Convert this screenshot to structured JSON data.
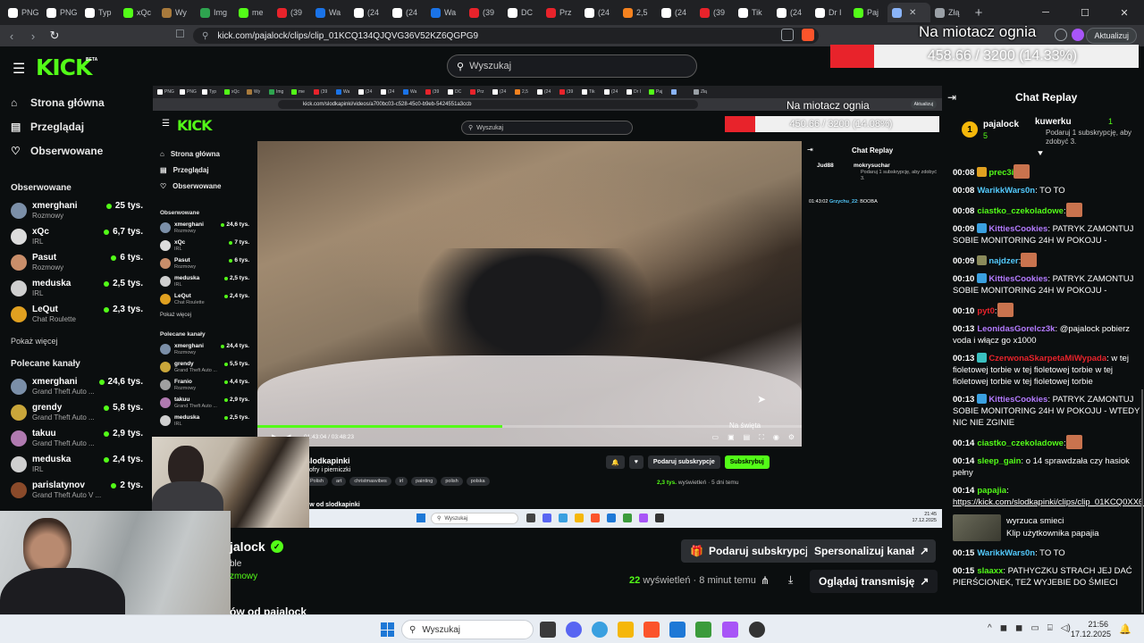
{
  "browser": {
    "tabs": [
      {
        "label": "PNG",
        "color": "#ffffff"
      },
      {
        "label": "PNG",
        "color": "#ffffff"
      },
      {
        "label": "Typ",
        "color": "#ffffff"
      },
      {
        "label": "xQc",
        "color": "#53fc18"
      },
      {
        "label": "Wy",
        "color": "#a87a3c"
      },
      {
        "label": "Img",
        "color": "#2ea44f"
      },
      {
        "label": "me",
        "color": "#53fc18"
      },
      {
        "label": "(39",
        "color": "#e8232b"
      },
      {
        "label": "Wa",
        "color": "#1a73e8"
      },
      {
        "label": "(24",
        "color": "#ffffff"
      },
      {
        "label": "(24",
        "color": "#ffffff"
      },
      {
        "label": "Wa",
        "color": "#1a73e8"
      },
      {
        "label": "(39",
        "color": "#e8232b"
      },
      {
        "label": "DC",
        "color": "#ffffff"
      },
      {
        "label": "Prz",
        "color": "#e8232b"
      },
      {
        "label": "(24",
        "color": "#ffffff"
      },
      {
        "label": "2,5",
        "color": "#f5821f"
      },
      {
        "label": "(24",
        "color": "#ffffff"
      },
      {
        "label": "(39",
        "color": "#e8232b"
      },
      {
        "label": "Tik",
        "color": "#ffffff"
      },
      {
        "label": "(24",
        "color": "#ffffff"
      },
      {
        "label": "Dr I",
        "color": "#ffffff"
      },
      {
        "label": "Paj",
        "color": "#53fc18"
      },
      {
        "label": "",
        "color": "#8ab4f8"
      },
      {
        "label": "Złą",
        "color": "#9aa0a6"
      }
    ],
    "new_tab": "+",
    "url": "kick.com/pajalock/clips/clip_01KCQ134QJQVG36V52KZ6QGPG9",
    "update_label": "Aktualizuj"
  },
  "overlay": {
    "title": "Na miotacz ognia",
    "current": 458.66,
    "goal": 3200,
    "value_text": "458.66 / 3200 (14.33%)"
  },
  "kick": {
    "logo": "KICK",
    "beta": "BETA",
    "search_placeholder": "Wyszukaj",
    "nav": [
      {
        "label": "Strona główna",
        "icon": "home-icon"
      },
      {
        "label": "Przeglądaj",
        "icon": "browse-icon"
      },
      {
        "label": "Obserwowane",
        "icon": "heart-icon"
      }
    ],
    "followed_title": "Obserwowane",
    "followed": [
      {
        "name": "xmerghani",
        "category": "Rozmowy",
        "viewers": "25 tys.",
        "color": "#7b8fa8"
      },
      {
        "name": "xQc",
        "category": "IRL",
        "viewers": "6,7 tys.",
        "color": "#dcdcdc"
      },
      {
        "name": "Pasut",
        "category": "Rozmowy",
        "viewers": "6 tys.",
        "color": "#c98e6a"
      },
      {
        "name": "meduska",
        "category": "IRL",
        "viewers": "2,5 tys.",
        "color": "#cfcfcf"
      },
      {
        "name": "LeQut",
        "category": "Chat Roulette",
        "viewers": "2,3 tys.",
        "color": "#e0a020"
      }
    ],
    "show_more": "Pokaż więcej",
    "recommended_title": "Polecane kanały",
    "recommended": [
      {
        "name": "xmerghani",
        "category": "Grand Theft Auto ...",
        "viewers": "24,6 tys.",
        "color": "#7b8fa8"
      },
      {
        "name": "grendy",
        "category": "Grand Theft Auto ...",
        "viewers": "5,8 tys.",
        "color": "#c9a63a"
      },
      {
        "name": "takuu",
        "category": "Grand Theft Auto ...",
        "viewers": "2,9 tys.",
        "color": "#b07ab0"
      },
      {
        "name": "meduska",
        "category": "IRL",
        "viewers": "2,4 tys.",
        "color": "#cfcfcf"
      },
      {
        "name": "parislatynov",
        "category": "Grand Theft Auto V ...",
        "viewers": "2 tys.",
        "color": "#8a4a2a"
      }
    ]
  },
  "inner": {
    "url": "kick.com/slodkapinki/videos/a700bc03-c528-45c0-b9eb-5424551a3ccb",
    "overlay_title": "Na miotacz ognia",
    "overlay_current": 450.66,
    "overlay_goal": 3200,
    "overlay_text": "450.66 / 3200 (14.08%)",
    "search_placeholder": "Wyszukaj",
    "update_label": "Aktualizuj",
    "nav": [
      "Strona główna",
      "Przeglądaj",
      "Obserwowane"
    ],
    "followed_title": "Obserwowane",
    "followed": [
      {
        "name": "xmerghani",
        "category": "Rozmowy",
        "viewers": "24,6 tys.",
        "color": "#7b8fa8"
      },
      {
        "name": "xQc",
        "category": "IRL",
        "viewers": "7 tys.",
        "color": "#dcdcdc"
      },
      {
        "name": "Pasut",
        "category": "Rozmowy",
        "viewers": "6 tys.",
        "color": "#c98e6a"
      },
      {
        "name": "meduska",
        "category": "IRL",
        "viewers": "2,5 tys.",
        "color": "#cfcfcf"
      },
      {
        "name": "LeQut",
        "category": "Chat Roulette",
        "viewers": "2,4 tys.",
        "color": "#e0a020"
      }
    ],
    "show_more": "Pokaż więcej",
    "recommended_title": "Polecane kanały",
    "recommended": [
      {
        "name": "xmerghani",
        "category": "Rozmowy",
        "viewers": "24,4 tys.",
        "color": "#7b8fa8"
      },
      {
        "name": "grendy",
        "category": "Grand Theft Auto ...",
        "viewers": "5,5 tys.",
        "color": "#c9a63a"
      },
      {
        "name": "Franio",
        "category": "Rozmowy",
        "viewers": "4,4 tys.",
        "color": "#a0a0a0"
      },
      {
        "name": "takuu",
        "category": "Grand Theft Auto ...",
        "viewers": "2,9 tys.",
        "color": "#b07ab0"
      },
      {
        "name": "meduska",
        "category": "IRL",
        "viewers": "2,5 tys.",
        "color": "#cfcfcf"
      }
    ],
    "video_time": "01:43:04 / 03:48:23",
    "video_progress": 0.45,
    "video_caption": "Na święta",
    "chat_title": "Chat Replay",
    "chat_top_user": "Jud88",
    "chat_top_user2": "mokrysuchar",
    "chat_top_sub": "Podaruj 1 subskrypcję, aby zdobyć 3.",
    "chat_msg_time": "01:43:02",
    "chat_msg_user": "Grzychu_22",
    "chat_msg_text": ": BOOBA",
    "channel": "slodkapinki",
    "desc": "gofry i pierniczki",
    "tags": [
      "Polish",
      "art",
      "christmasvibes",
      "irl",
      "painting",
      "polish",
      "polska"
    ],
    "btn_gift": "Podaruj subskrypcje",
    "btn_sub": "Subskrybuj",
    "views": "2,3 tys.",
    "views_label": "wyświetleń",
    "age": "5 dni temu",
    "vod_title": "ów od slodkapinki",
    "taskbar_search": "Wyszukaj",
    "clock_time": "21:45",
    "clock_date": "17.12.2025"
  },
  "clip": {
    "owner": "jalock",
    "sub1": "ble",
    "sub2": "zmowy",
    "btn_gift": "Podaruj subskrypcje",
    "btn_custom": "Spersonalizuj kanał",
    "views": "22",
    "views_label": "wyświetleń",
    "age": "8 minut temu",
    "btn_watch": "Oglądaj transmisję",
    "vod_title": "ów od pajalock"
  },
  "chat": {
    "title": "Chat Replay",
    "pinned_user": "pajalock",
    "pinned_count": "5",
    "pinned_user2": "kuwerku",
    "pinned_count2": "1",
    "pinned_sub": "Podaruj 1 subskrypcję, aby zdobyć 3.",
    "messages": [
      {
        "time": "00:08",
        "user": "prec3i",
        "color": "#53fc18",
        "text": "",
        "emote": true,
        "badge": "#e0a020"
      },
      {
        "time": "00:08",
        "user": "WarikkWars0n",
        "color": "#53c9fc",
        "text": ": TO TO",
        "emote": false,
        "badge": ""
      },
      {
        "time": "00:08",
        "user": "ciastko_czekoladowe",
        "color": "#53fc18",
        "text": ":",
        "emote": true,
        "badge": ""
      },
      {
        "time": "00:09",
        "user": "KittiesCookies",
        "color": "#b47bff",
        "text": ": PATRYK ZAMONTUJ SOBIE MONITORING 24H W POKOJU -",
        "emote": false,
        "badge": "#3aa0e0"
      },
      {
        "time": "00:09",
        "user": "najdzer",
        "color": "#53c9fc",
        "text": ":",
        "emote": true,
        "badge": "#8a8a5a"
      },
      {
        "time": "00:10",
        "user": "KittiesCookies",
        "color": "#b47bff",
        "text": ": PATRYK ZAMONTUJ SOBIE MONITORING 24H W POKOJU -",
        "emote": false,
        "badge": "#3aa0e0"
      },
      {
        "time": "00:10",
        "user": "pyt0",
        "color": "#e8232b",
        "text": ":",
        "emote": true,
        "badge": ""
      },
      {
        "time": "00:13",
        "user": "LeonidasGorelcz3k",
        "color": "#b47bff",
        "text": ": @pajalock pobierz voda i włącz go x1000",
        "emote": false,
        "badge": ""
      },
      {
        "time": "00:13",
        "user": "CzerwonaSkarpetaMiWypada",
        "color": "#e8232b",
        "text": ": w tej fioletowej torbie w tej fioletowej torbie w tej fioletowej torbie w tej fioletowej torbie",
        "emote": false,
        "badge": "#3ac0c0"
      },
      {
        "time": "00:13",
        "user": "KittiesCookies",
        "color": "#b47bff",
        "text": ": PATRYK ZAMONTUJ SOBIE MONITORING 24H W POKOJU - WTEDY NIC NIE ZGINIE",
        "emote": false,
        "badge": "#3aa0e0"
      },
      {
        "time": "00:14",
        "user": "ciastko_czekoladowe",
        "color": "#53fc18",
        "text": ":",
        "emote": true,
        "badge": ""
      },
      {
        "time": "00:14",
        "user": "sleep_gain",
        "color": "#53fc18",
        "text": ": o 14 sprawdzała czy hasiok pełny",
        "emote": false,
        "badge": ""
      },
      {
        "time": "00:14",
        "user": "papajia",
        "color": "#53fc18",
        "text": ":",
        "emote": false,
        "badge": ""
      }
    ],
    "link": "https://kick.com/slodkapinki/clips/clip_01KCQ0XX6EJRM0875Z4GBDWAAJ",
    "clip_card_title": "wyrzuca smieci",
    "clip_card_sub": "Klip użytkownika papajia",
    "messages2": [
      {
        "time": "00:15",
        "user": "WarikkWars0n",
        "color": "#53c9fc",
        "text": ": TO TO",
        "badge": ""
      },
      {
        "time": "00:15",
        "user": "slaaxx",
        "color": "#53fc18",
        "text": ": PATHYCZKU STRACH JEJ DAĆ PIERŚCIONEK, TEŻ WYJEBIE DO ŚMIECI",
        "badge": ""
      }
    ]
  },
  "taskbar": {
    "search_placeholder": "Wyszukaj",
    "time": "21:56",
    "date": "17.12.2025"
  }
}
